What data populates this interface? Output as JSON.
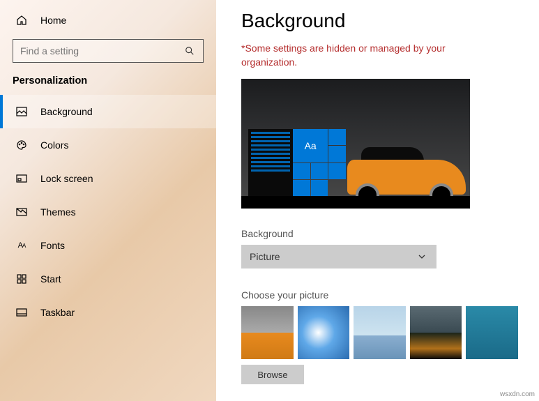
{
  "home_label": "Home",
  "search_placeholder": "Find a setting",
  "section_title": "Personalization",
  "nav": [
    {
      "label": "Background",
      "active": true
    },
    {
      "label": "Colors"
    },
    {
      "label": "Lock screen"
    },
    {
      "label": "Themes"
    },
    {
      "label": "Fonts"
    },
    {
      "label": "Start"
    },
    {
      "label": "Taskbar"
    }
  ],
  "page_title": "Background",
  "warning_text": "*Some settings are hidden or managed by your organization.",
  "preview_tile_text": "Aa",
  "bg_label": "Background",
  "bg_dropdown_value": "Picture",
  "choose_label": "Choose your picture",
  "browse_label": "Browse",
  "watermark": "wsxdn.com"
}
